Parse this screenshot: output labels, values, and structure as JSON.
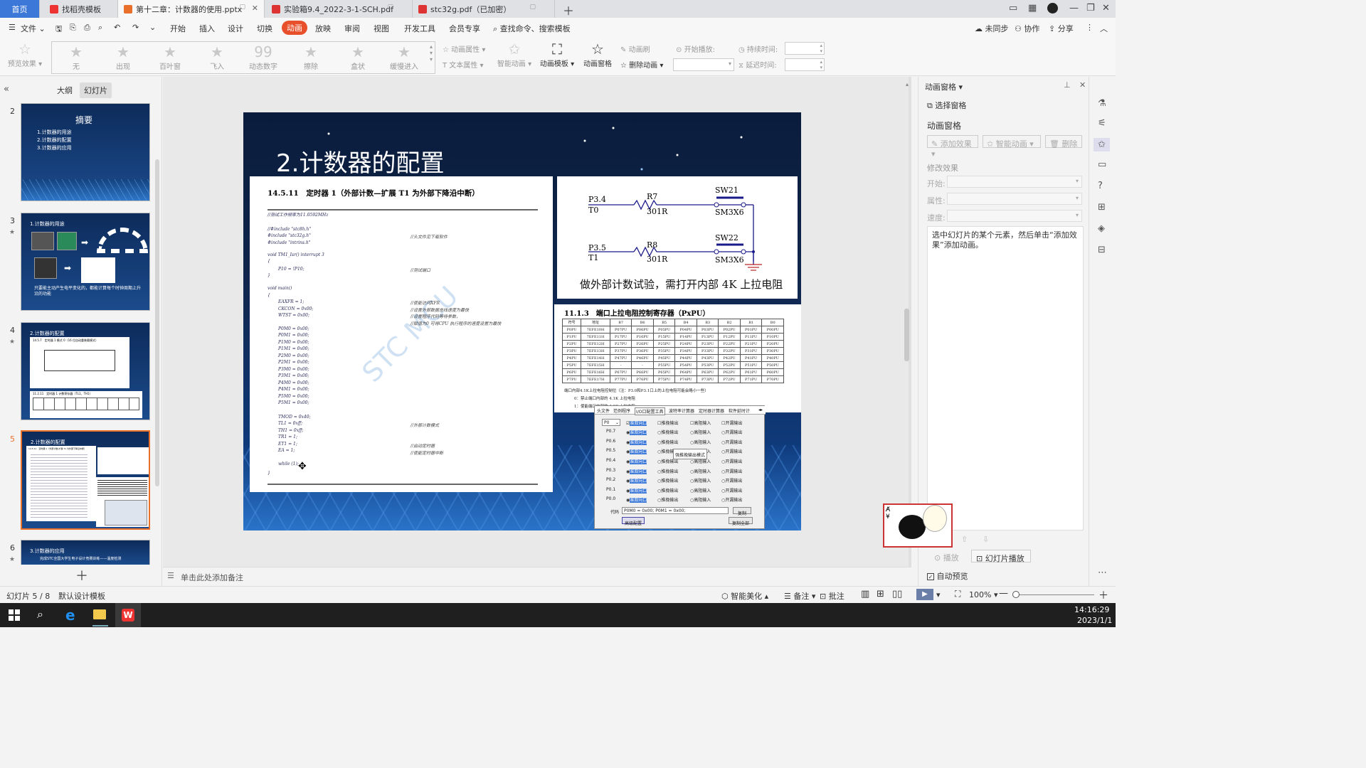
{
  "tabs": [
    {
      "label": "首页",
      "type": "home"
    },
    {
      "label": "找稻壳模板",
      "type": "wps"
    },
    {
      "label": "第十二章：计数器的使用.pptx",
      "type": "ppt",
      "active": true
    },
    {
      "label": "实验箱9.4_2022-3-1-SCH.pdf",
      "type": "pdf"
    },
    {
      "label": "stc32g.pdf（已加密）",
      "type": "pdf"
    }
  ],
  "menu": {
    "file": "文件",
    "items": [
      "开始",
      "插入",
      "设计",
      "切换",
      "动画",
      "放映",
      "审阅",
      "视图",
      "开发工具",
      "会员专享"
    ],
    "active": "动画",
    "search": "查找命令、搜索模板",
    "unsync": "未同步",
    "collab": "协作",
    "share": "分享"
  },
  "ribbon": {
    "preview": "预览效果",
    "effects": [
      "无",
      "出现",
      "百叶窗",
      "飞入",
      "动态数字",
      "擦除",
      "盒状",
      "缓慢进入"
    ],
    "anim_props": "动画属性",
    "text_props": "文本属性",
    "smart_anim": "智能动画",
    "anim_template": "动画模板",
    "anim_pane": "动画窗格",
    "anim_brush": "动画刷",
    "delete_anim": "删除动画",
    "start_play": "开始播放:",
    "duration": "持续时间:",
    "delay": "延迟时间:"
  },
  "left_panel": {
    "tab_outline": "大纲",
    "tab_slides": "幻灯片",
    "slides": [
      {
        "num": "2",
        "title": "摘要",
        "lines": [
          "1.计数器的用途",
          "2.计数器的配置",
          "3.计数器的应用"
        ]
      },
      {
        "num": "3",
        "title": "1.计数器的用途",
        "caption": "只要能主动产生电平变化的，都能计算每个时钟周期上升沿的功能"
      },
      {
        "num": "4",
        "title": "2.计数器的配置",
        "sub1": "14.5.7　定时器 1 模式 0（16 位自动重装载模式）",
        "sub2": "11.2.11　定时器 1 计数寄存器（TL1、TH1）"
      },
      {
        "num": "5",
        "title": "2.计数器的配置",
        "sub1": "14.5.11　定时器 1（外部计数-扩展 T1 为外部下降沿中断）"
      },
      {
        "num": "6",
        "title": "3.计数器的应用",
        "caption": "完成STC全国大学生电子设计竞赛训练——温度检测"
      }
    ]
  },
  "slide": {
    "title": "2.计数器的配置",
    "doc_heading": "14.5.11　定时器 1（外部计数—扩展 T1 为外部下降沿中断）",
    "watermark": "STC MCU",
    "code": [
      "//测试工作频率为11.0592MHz",
      "//#include \"stc8h.h\"",
      "#include \"stc32g.h\"",
      "#include \"intrins.h\"",
      "void TM1_Isr() interrupt 3",
      "{",
      "P10 = !P10;",
      "}",
      "void main()",
      "{",
      "EAXFR = 1;",
      "CKCON = 0x00;",
      "WTST = 0x00;",
      "P0M0 = 0x00;",
      "P0M1 = 0x00;",
      "P1M0 = 0x00;",
      "P1M1 = 0x00;",
      "P2M0 = 0x00;",
      "P2M1 = 0x00;",
      "P3M0 = 0x00;",
      "P3M1 = 0x00;",
      "P4M0 = 0x00;",
      "P4M1 = 0x00;",
      "P5M0 = 0x00;",
      "P5M1 = 0x00;",
      "TMOD = 0x40;",
      "TL1 = 0xff;",
      "TH1 = 0xff;",
      "TR1 = 1;",
      "ET1 = 1;",
      "EA = 1;",
      "while (1);",
      "}"
    ],
    "comments": [
      "//头文件见下载软件",
      "//测试端口",
      "//使能访问XFR",
      "//设置外部数据总线速度为最快",
      "//设置程序代码等待参数，",
      "//赋值为0 可将CPU 执行程序的速度设置为最快",
      "//外部计数模式",
      "//启动定时器",
      "//使能定时器中断"
    ],
    "circuit": {
      "p34": "P3.4",
      "t0": "T0",
      "r7": "R7",
      "r7v": "301R",
      "sw21": "SW21",
      "sm1": "SM3X6",
      "p35": "P3.5",
      "t1": "T1",
      "r8": "R8",
      "r8v": "301R",
      "sw22": "SW22",
      "sm2": "SM3X6",
      "caption": "做外部计数试验，需打开内部 4K 上拉电阻"
    },
    "reg_heading": "11.1.3　端口上拉电阻控制寄存器（PxPU）",
    "reg_headers": [
      "符号",
      "地址",
      "B7",
      "B6",
      "B5",
      "B4",
      "B3",
      "B2",
      "B1",
      "B0"
    ],
    "reg_rows": [
      [
        "P0PU",
        "7EFE10H",
        "P07PU",
        "P06PU",
        "P05PU",
        "P04PU",
        "P03PU",
        "P02PU",
        "P01PU",
        "P00PU"
      ],
      [
        "P1PU",
        "7EFE11H",
        "P17PU",
        "P16PU",
        "P15PU",
        "P14PU",
        "P13PU",
        "P12PU",
        "P11PU",
        "P10PU"
      ],
      [
        "P2PU",
        "7EFE12H",
        "P27PU",
        "P26PU",
        "P25PU",
        "P24PU",
        "P23PU",
        "P22PU",
        "P21PU",
        "P20PU"
      ],
      [
        "P3PU",
        "7EFE13H",
        "P37PU",
        "P36PU",
        "P35PU",
        "P34PU",
        "P33PU",
        "P32PU",
        "P31PU",
        "P30PU"
      ],
      [
        "P4PU",
        "7EFE14H",
        "P47PU",
        "P46PU",
        "P45PU",
        "P44PU",
        "P43PU",
        "P42PU",
        "P41PU",
        "P40PU"
      ],
      [
        "P5PU",
        "7EFE15H",
        "-",
        "-",
        "P55PU",
        "P54PU",
        "P53PU",
        "P52PU",
        "P51PU",
        "P50PU"
      ],
      [
        "P6PU",
        "7EFE16H",
        "P67PU",
        "P66PU",
        "P65PU",
        "P64PU",
        "P63PU",
        "P62PU",
        "P61PU",
        "P60PU"
      ],
      [
        "P7PU",
        "7EFE17H",
        "P77PU",
        "P76PU",
        "P75PU",
        "P74PU",
        "P73PU",
        "P72PU",
        "P71PU",
        "P70PU"
      ]
    ],
    "reg_note1": "端口内部4.1K上拉电阻控制位（注：P3.0和P3.1口上的上拉电阻可能会略小一些）",
    "reg_note2": "0：禁止端口内部的 4.1K 上拉电阻",
    "reg_note3": "1：使能端口内部的 4.1K 上拉电阻",
    "tool": {
      "tabs": [
        "头文件",
        "范例程序",
        "I/O口配置工具",
        "波特率计算器",
        "定时器计算器",
        "软件延时计"
      ],
      "port": "P0",
      "rows": [
        "P0.7",
        "P0.6",
        "P0.5",
        "P0.4",
        "P0.3",
        "P0.2",
        "P0.1",
        "P0.0"
      ],
      "opts": [
        "准双向口",
        "推挽输出",
        "高阻输入",
        "开漏输出"
      ],
      "tooltip": "强推挽输出模式",
      "code_label": "代码",
      "code_value": "P0M0 = 0x00;  P0M1 = 0x00;",
      "copy": "复制",
      "high": "高级配置",
      "copy_all": "复制全部"
    }
  },
  "notes_placeholder": "单击此处添加备注",
  "right_panel": {
    "title": "动画窗格",
    "select_pane": "选择窗格",
    "section": "动画窗格",
    "add_effect": "添加效果",
    "smart_anim": "智能动画",
    "delete": "删除",
    "modify": "修改效果",
    "start": "开始:",
    "prop": "属性:",
    "speed": "速度:",
    "hint": "选中幻灯片的某个元素，然后单击“添加效果”添加动画。",
    "play": "播放",
    "slideshow": "幻灯片播放",
    "auto_preview": "自动预览"
  },
  "status": {
    "slide_info": "幻灯片 5 / 8",
    "template": "默认设计模板",
    "beautify": "智能美化",
    "notes": "备注",
    "comment": "批注",
    "zoom": "100%"
  },
  "taskbar": {
    "time": "14:16:29",
    "date": "2023/1/1"
  },
  "colors": {
    "accent": "#e8502b",
    "home_tab": "#3c78d8",
    "selected_thumb": "#e8702b"
  }
}
